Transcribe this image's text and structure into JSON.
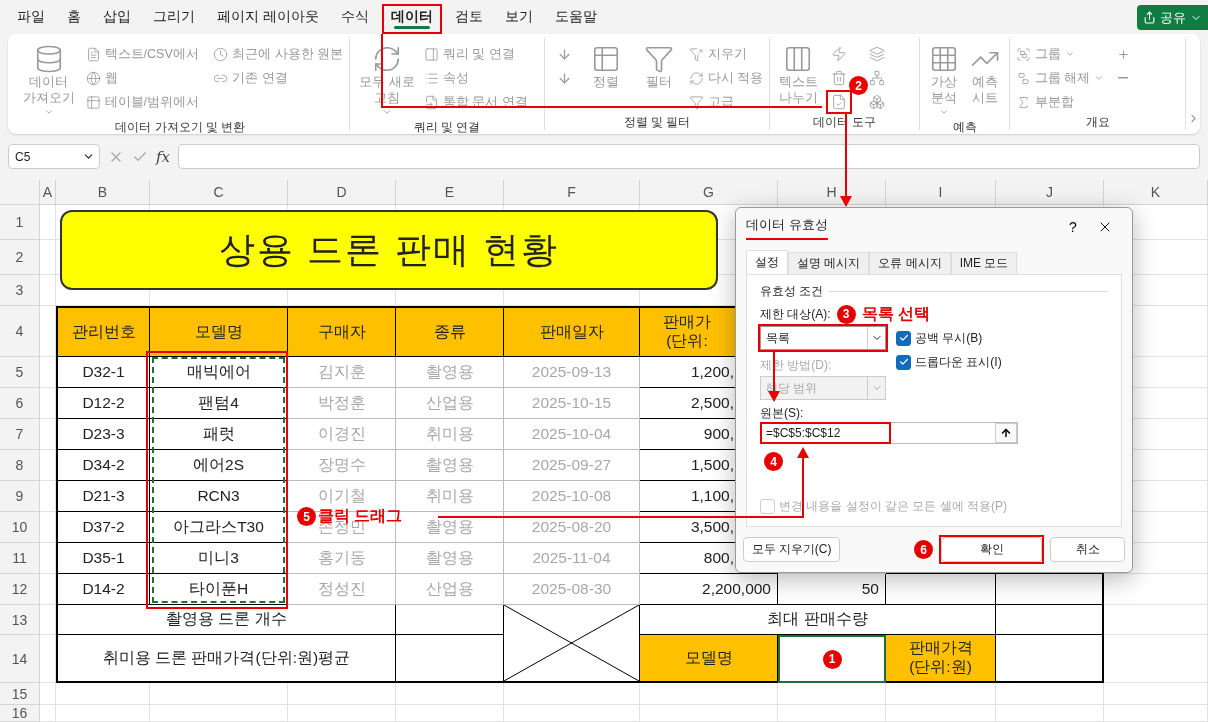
{
  "menu_tabs": [
    {
      "label": "파일",
      "selected": false
    },
    {
      "label": "홈",
      "selected": false
    },
    {
      "label": "삽입",
      "selected": false
    },
    {
      "label": "그리기",
      "selected": false
    },
    {
      "label": "페이지 레이아웃",
      "selected": false
    },
    {
      "label": "수식",
      "selected": false
    },
    {
      "label": "데이터",
      "selected": true
    },
    {
      "label": "검토",
      "selected": false
    },
    {
      "label": "보기",
      "selected": false
    },
    {
      "label": "도움말",
      "selected": false
    }
  ],
  "share_button": "공유",
  "ribbon_groups": [
    {
      "label": "데이터 가져오기 및 변환",
      "items": [
        {
          "kind": "large",
          "label": "데이터 가져오기",
          "menu": true
        },
        {
          "kind": "small",
          "label": "텍스트/CSV에서"
        },
        {
          "kind": "small",
          "label": "웹"
        },
        {
          "kind": "small",
          "label": "테이블/범위에서"
        },
        {
          "kind": "small",
          "label": "최근에 사용한 원본"
        },
        {
          "kind": "small",
          "label": "기존 연결"
        }
      ]
    },
    {
      "label": "쿼리 및 연결",
      "items": [
        {
          "kind": "large",
          "label": "모두 새로 고침",
          "menu": true
        },
        {
          "kind": "small",
          "label": "쿼리 및 연결"
        },
        {
          "kind": "small",
          "label": "속성"
        },
        {
          "kind": "small",
          "label": "통합 문서 연결"
        }
      ]
    },
    {
      "label": "정렬 및 필터",
      "items": [
        {
          "kind": "large",
          "label": "정렬"
        },
        {
          "kind": "large",
          "label": "필터"
        },
        {
          "kind": "small",
          "label": "지우기"
        },
        {
          "kind": "small",
          "label": "다시 적용"
        },
        {
          "kind": "small",
          "label": "고급"
        }
      ]
    },
    {
      "label": "데이터 도구",
      "items": [
        {
          "kind": "large",
          "label": "텍스트 나누기"
        }
      ]
    },
    {
      "label": "예측",
      "items": [
        {
          "kind": "large",
          "label": "가상 분석",
          "menu": true
        },
        {
          "kind": "large",
          "label": "예측 시트"
        }
      ]
    },
    {
      "label": "개요",
      "items": [
        {
          "kind": "small",
          "label": "그룹",
          "menu": true
        },
        {
          "kind": "small",
          "label": "그룹 해제",
          "menu": true
        },
        {
          "kind": "small",
          "label": "부분합"
        }
      ]
    }
  ],
  "formula_bar": {
    "name_box": "C5",
    "fx": "fx"
  },
  "columns": [
    "A",
    "B",
    "C",
    "D",
    "E",
    "F",
    "G",
    "H",
    "I",
    "J",
    "K"
  ],
  "rows": [
    "1",
    "2",
    "3",
    "4",
    "5",
    "6",
    "7",
    "8",
    "9",
    "10",
    "11",
    "12",
    "13",
    "14",
    "15",
    "16"
  ],
  "title": "상용 드론 판매 현황",
  "table": {
    "headers": [
      "관리번호",
      "모델명",
      "구매자",
      "종류",
      "판매일자",
      "판매가\n(단위:"
    ],
    "rows": [
      [
        "D32-1",
        "매빅에어",
        "김지훈",
        "촬영용",
        "2025-09-13",
        "1,200,"
      ],
      [
        "D12-2",
        "팬텀4",
        "박정훈",
        "산업용",
        "2025-10-15",
        "2,500,"
      ],
      [
        "D23-3",
        "패럿",
        "이경진",
        "취미용",
        "2025-10-04",
        "900,"
      ],
      [
        "D34-2",
        "에어2S",
        "장명수",
        "촬영용",
        "2025-09-27",
        "1,500,"
      ],
      [
        "D21-3",
        "RCN3",
        "이기철",
        "취미용",
        "2025-10-08",
        "1,100,"
      ],
      [
        "D37-2",
        "아그라스T30",
        "손정민",
        "촬영용",
        "2025-08-20",
        "3,500,"
      ],
      [
        "D35-1",
        "미니3",
        "홍기동",
        "촬영용",
        "2025-11-04",
        "800,"
      ],
      [
        "D14-2",
        "타이푼H",
        "정성진",
        "산업용",
        "2025-08-30",
        "2,200,000",
        "50"
      ]
    ]
  },
  "summary": {
    "drone_count_label": "촬영용 드론 개수",
    "hobby_avg_label": "취미용 드론 판매가격(단위:원)평균",
    "max_label": "최대 판매수량",
    "model_label": "모델명",
    "price_label": "판매가격\n(단위:원)"
  },
  "dialog": {
    "title": "데이터 유효성",
    "help": "?",
    "tabs": [
      {
        "label": "설정",
        "selected": true
      },
      {
        "label": "설명 메시지",
        "selected": false
      },
      {
        "label": "오류 메시지",
        "selected": false
      },
      {
        "label": "IME 모드",
        "selected": false
      }
    ],
    "section": "유효성 조건",
    "allow_label": "제한 대상(A):",
    "allow_value": "목록",
    "data_label": "제한 방법(D):",
    "data_value": "해당 범위",
    "data_disabled": true,
    "checkboxes": [
      {
        "label": "공백 무시(B)",
        "checked": true
      },
      {
        "label": "드롭다운 표시(I)",
        "checked": true
      }
    ],
    "source_label": "원본(S):",
    "source_value": "=$C$5:$C$12",
    "apply_all": {
      "label": "변경 내용을 설정이 같은 모든 셀에 적용(P)",
      "checked": false,
      "disabled": true
    },
    "buttons": {
      "clear": "모두 지우기(C)",
      "ok": "확인",
      "cancel": "취소"
    }
  },
  "annotations": {
    "badges": [
      "1",
      "2",
      "3",
      "4",
      "5",
      "6"
    ],
    "list_note": "목록 선택",
    "drag_note": "클릭 드래그"
  }
}
